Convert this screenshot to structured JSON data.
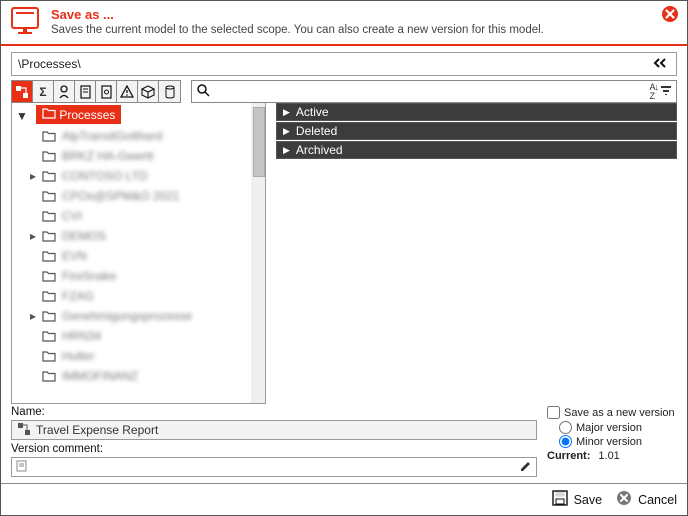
{
  "header": {
    "title": "Save as ...",
    "subtitle": "Saves the current model to the selected scope. You can also create a new version for this model."
  },
  "breadcrumb": "\\Processes\\",
  "tree": {
    "root": "Processes",
    "items": [
      {
        "label": "AlpTransitGotthard",
        "caret": false
      },
      {
        "label": "BRKZ HA-Gwertt",
        "caret": false
      },
      {
        "label": "CONTOSO LTD",
        "caret": true
      },
      {
        "label": "CPOs@SPM&O 2021",
        "caret": false
      },
      {
        "label": "CVI",
        "caret": false
      },
      {
        "label": "DEMOS",
        "caret": true
      },
      {
        "label": "EVN",
        "caret": false
      },
      {
        "label": "FireSnake",
        "caret": false
      },
      {
        "label": "FZAG",
        "caret": false
      },
      {
        "label": "Genehmigungsprozesse",
        "caret": true
      },
      {
        "label": "HRN34",
        "caret": false
      },
      {
        "label": "Hutter",
        "caret": false
      },
      {
        "label": "IMMOFINANZ",
        "caret": false
      }
    ]
  },
  "statuses": [
    "Active",
    "Deleted",
    "Archived"
  ],
  "lower": {
    "name_label": "Name:",
    "name_value": "Travel Expense Report",
    "vc_label": "Version comment:",
    "save_new_label": "Save as a new version",
    "major_label": "Major version",
    "minor_label": "Minor version",
    "current_label": "Current:",
    "current_value": "1.01"
  },
  "footer": {
    "save": "Save",
    "cancel": "Cancel"
  }
}
